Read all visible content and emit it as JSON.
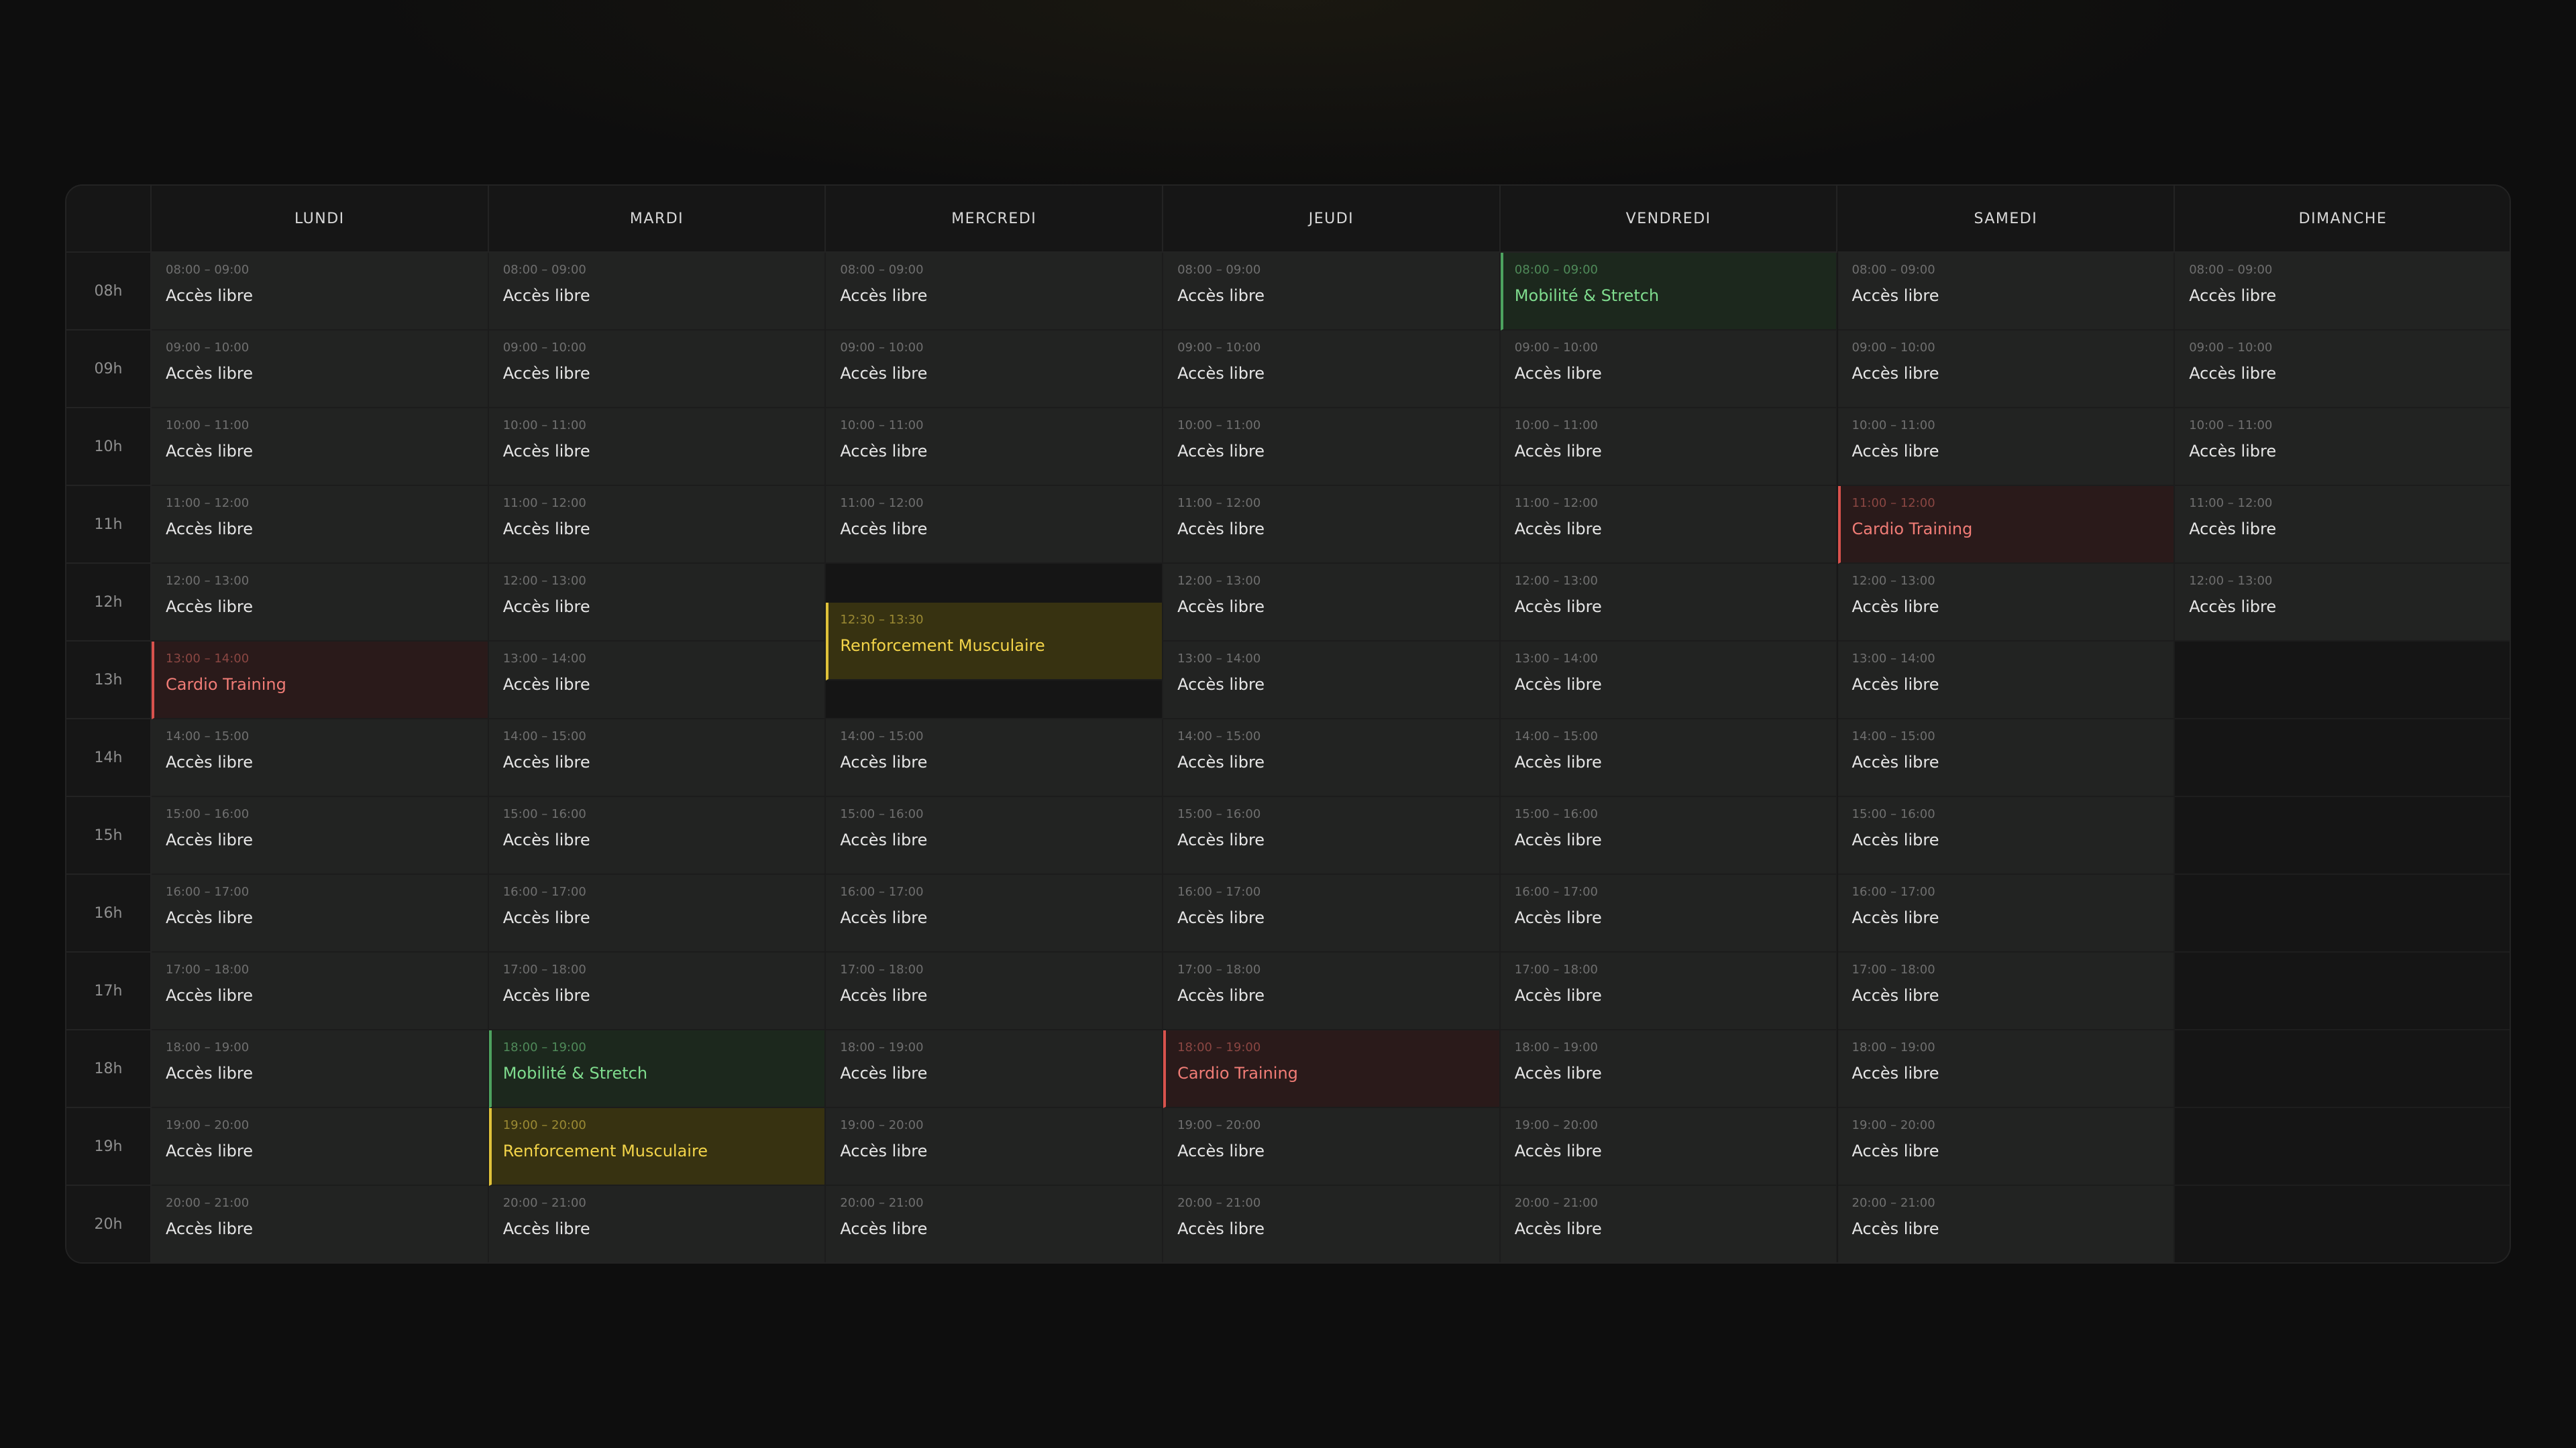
{
  "days": [
    "LUNDI",
    "MARDI",
    "MERCREDI",
    "JEUDI",
    "VENDREDI",
    "SAMEDI",
    "DIMANCHE"
  ],
  "hours": [
    "08h",
    "09h",
    "10h",
    "11h",
    "12h",
    "13h",
    "14h",
    "15h",
    "16h",
    "17h",
    "18h",
    "19h",
    "20h"
  ],
  "colors": {
    "cardio": "#f07c76",
    "mobility": "#7fdc8e",
    "strength": "#f3d449",
    "free": "#e6e6e6"
  },
  "columns": [
    [
      {
        "start": 0,
        "dur": 1,
        "time": "08:00 – 09:00",
        "label": "Accès libre",
        "type": "free"
      },
      {
        "start": 1,
        "dur": 1,
        "time": "09:00 – 10:00",
        "label": "Accès libre",
        "type": "free"
      },
      {
        "start": 2,
        "dur": 1,
        "time": "10:00 – 11:00",
        "label": "Accès libre",
        "type": "free"
      },
      {
        "start": 3,
        "dur": 1,
        "time": "11:00 – 12:00",
        "label": "Accès libre",
        "type": "free"
      },
      {
        "start": 4,
        "dur": 1,
        "time": "12:00 – 13:00",
        "label": "Accès libre",
        "type": "free"
      },
      {
        "start": 5,
        "dur": 1,
        "time": "13:00 – 14:00",
        "label": "Cardio Training",
        "type": "cardio"
      },
      {
        "start": 6,
        "dur": 1,
        "time": "14:00 – 15:00",
        "label": "Accès libre",
        "type": "free"
      },
      {
        "start": 7,
        "dur": 1,
        "time": "15:00 – 16:00",
        "label": "Accès libre",
        "type": "free"
      },
      {
        "start": 8,
        "dur": 1,
        "time": "16:00 – 17:00",
        "label": "Accès libre",
        "type": "free"
      },
      {
        "start": 9,
        "dur": 1,
        "time": "17:00 – 18:00",
        "label": "Accès libre",
        "type": "free"
      },
      {
        "start": 10,
        "dur": 1,
        "time": "18:00 – 19:00",
        "label": "Accès libre",
        "type": "free"
      },
      {
        "start": 11,
        "dur": 1,
        "time": "19:00 – 20:00",
        "label": "Accès libre",
        "type": "free"
      },
      {
        "start": 12,
        "dur": 1,
        "time": "20:00 – 21:00",
        "label": "Accès libre",
        "type": "free"
      }
    ],
    [
      {
        "start": 0,
        "dur": 1,
        "time": "08:00 – 09:00",
        "label": "Accès libre",
        "type": "free"
      },
      {
        "start": 1,
        "dur": 1,
        "time": "09:00 – 10:00",
        "label": "Accès libre",
        "type": "free"
      },
      {
        "start": 2,
        "dur": 1,
        "time": "10:00 – 11:00",
        "label": "Accès libre",
        "type": "free"
      },
      {
        "start": 3,
        "dur": 1,
        "time": "11:00 – 12:00",
        "label": "Accès libre",
        "type": "free"
      },
      {
        "start": 4,
        "dur": 1,
        "time": "12:00 – 13:00",
        "label": "Accès libre",
        "type": "free"
      },
      {
        "start": 5,
        "dur": 1,
        "time": "13:00 – 14:00",
        "label": "Accès libre",
        "type": "free"
      },
      {
        "start": 6,
        "dur": 1,
        "time": "14:00 – 15:00",
        "label": "Accès libre",
        "type": "free"
      },
      {
        "start": 7,
        "dur": 1,
        "time": "15:00 – 16:00",
        "label": "Accès libre",
        "type": "free"
      },
      {
        "start": 8,
        "dur": 1,
        "time": "16:00 – 17:00",
        "label": "Accès libre",
        "type": "free"
      },
      {
        "start": 9,
        "dur": 1,
        "time": "17:00 – 18:00",
        "label": "Accès libre",
        "type": "free"
      },
      {
        "start": 10,
        "dur": 1,
        "time": "18:00 – 19:00",
        "label": "Mobilité & Stretch",
        "type": "mobility"
      },
      {
        "start": 11,
        "dur": 1,
        "time": "19:00 – 20:00",
        "label": "Renforcement Musculaire",
        "type": "strength"
      },
      {
        "start": 12,
        "dur": 1,
        "time": "20:00 – 21:00",
        "label": "Accès libre",
        "type": "free"
      }
    ],
    [
      {
        "start": 0,
        "dur": 1,
        "time": "08:00 – 09:00",
        "label": "Accès libre",
        "type": "free"
      },
      {
        "start": 1,
        "dur": 1,
        "time": "09:00 – 10:00",
        "label": "Accès libre",
        "type": "free"
      },
      {
        "start": 2,
        "dur": 1,
        "time": "10:00 – 11:00",
        "label": "Accès libre",
        "type": "free"
      },
      {
        "start": 3,
        "dur": 1,
        "time": "11:00 – 12:00",
        "label": "Accès libre",
        "type": "free"
      },
      {
        "start": 4.5,
        "dur": 1,
        "time": "12:30 – 13:30",
        "label": "Renforcement Musculaire",
        "type": "strength"
      },
      {
        "start": 6,
        "dur": 1,
        "time": "14:00 – 15:00",
        "label": "Accès libre",
        "type": "free"
      },
      {
        "start": 7,
        "dur": 1,
        "time": "15:00 – 16:00",
        "label": "Accès libre",
        "type": "free"
      },
      {
        "start": 8,
        "dur": 1,
        "time": "16:00 – 17:00",
        "label": "Accès libre",
        "type": "free"
      },
      {
        "start": 9,
        "dur": 1,
        "time": "17:00 – 18:00",
        "label": "Accès libre",
        "type": "free"
      },
      {
        "start": 10,
        "dur": 1,
        "time": "18:00 – 19:00",
        "label": "Accès libre",
        "type": "free"
      },
      {
        "start": 11,
        "dur": 1,
        "time": "19:00 – 20:00",
        "label": "Accès libre",
        "type": "free"
      },
      {
        "start": 12,
        "dur": 1,
        "time": "20:00 – 21:00",
        "label": "Accès libre",
        "type": "free"
      }
    ],
    [
      {
        "start": 0,
        "dur": 1,
        "time": "08:00 – 09:00",
        "label": "Accès libre",
        "type": "free"
      },
      {
        "start": 1,
        "dur": 1,
        "time": "09:00 – 10:00",
        "label": "Accès libre",
        "type": "free"
      },
      {
        "start": 2,
        "dur": 1,
        "time": "10:00 – 11:00",
        "label": "Accès libre",
        "type": "free"
      },
      {
        "start": 3,
        "dur": 1,
        "time": "11:00 – 12:00",
        "label": "Accès libre",
        "type": "free"
      },
      {
        "start": 4,
        "dur": 1,
        "time": "12:00 – 13:00",
        "label": "Accès libre",
        "type": "free"
      },
      {
        "start": 5,
        "dur": 1,
        "time": "13:00 – 14:00",
        "label": "Accès libre",
        "type": "free"
      },
      {
        "start": 6,
        "dur": 1,
        "time": "14:00 – 15:00",
        "label": "Accès libre",
        "type": "free"
      },
      {
        "start": 7,
        "dur": 1,
        "time": "15:00 – 16:00",
        "label": "Accès libre",
        "type": "free"
      },
      {
        "start": 8,
        "dur": 1,
        "time": "16:00 – 17:00",
        "label": "Accès libre",
        "type": "free"
      },
      {
        "start": 9,
        "dur": 1,
        "time": "17:00 – 18:00",
        "label": "Accès libre",
        "type": "free"
      },
      {
        "start": 10,
        "dur": 1,
        "time": "18:00 – 19:00",
        "label": "Cardio Training",
        "type": "cardio"
      },
      {
        "start": 11,
        "dur": 1,
        "time": "19:00 – 20:00",
        "label": "Accès libre",
        "type": "free"
      },
      {
        "start": 12,
        "dur": 1,
        "time": "20:00 – 21:00",
        "label": "Accès libre",
        "type": "free"
      }
    ],
    [
      {
        "start": 0,
        "dur": 1,
        "time": "08:00 – 09:00",
        "label": "Mobilité & Stretch",
        "type": "mobility"
      },
      {
        "start": 1,
        "dur": 1,
        "time": "09:00 – 10:00",
        "label": "Accès libre",
        "type": "free"
      },
      {
        "start": 2,
        "dur": 1,
        "time": "10:00 – 11:00",
        "label": "Accès libre",
        "type": "free"
      },
      {
        "start": 3,
        "dur": 1,
        "time": "11:00 – 12:00",
        "label": "Accès libre",
        "type": "free"
      },
      {
        "start": 4,
        "dur": 1,
        "time": "12:00 – 13:00",
        "label": "Accès libre",
        "type": "free"
      },
      {
        "start": 5,
        "dur": 1,
        "time": "13:00 – 14:00",
        "label": "Accès libre",
        "type": "free"
      },
      {
        "start": 6,
        "dur": 1,
        "time": "14:00 – 15:00",
        "label": "Accès libre",
        "type": "free"
      },
      {
        "start": 7,
        "dur": 1,
        "time": "15:00 – 16:00",
        "label": "Accès libre",
        "type": "free"
      },
      {
        "start": 8,
        "dur": 1,
        "time": "16:00 – 17:00",
        "label": "Accès libre",
        "type": "free"
      },
      {
        "start": 9,
        "dur": 1,
        "time": "17:00 – 18:00",
        "label": "Accès libre",
        "type": "free"
      },
      {
        "start": 10,
        "dur": 1,
        "time": "18:00 – 19:00",
        "label": "Accès libre",
        "type": "free"
      },
      {
        "start": 11,
        "dur": 1,
        "time": "19:00 – 20:00",
        "label": "Accès libre",
        "type": "free"
      },
      {
        "start": 12,
        "dur": 1,
        "time": "20:00 – 21:00",
        "label": "Accès libre",
        "type": "free"
      }
    ],
    [
      {
        "start": 0,
        "dur": 1,
        "time": "08:00 – 09:00",
        "label": "Accès libre",
        "type": "free"
      },
      {
        "start": 1,
        "dur": 1,
        "time": "09:00 – 10:00",
        "label": "Accès libre",
        "type": "free"
      },
      {
        "start": 2,
        "dur": 1,
        "time": "10:00 – 11:00",
        "label": "Accès libre",
        "type": "free"
      },
      {
        "start": 3,
        "dur": 1,
        "time": "11:00 – 12:00",
        "label": "Cardio Training",
        "type": "cardio"
      },
      {
        "start": 4,
        "dur": 1,
        "time": "12:00 – 13:00",
        "label": "Accès libre",
        "type": "free"
      },
      {
        "start": 5,
        "dur": 1,
        "time": "13:00 – 14:00",
        "label": "Accès libre",
        "type": "free"
      },
      {
        "start": 6,
        "dur": 1,
        "time": "14:00 – 15:00",
        "label": "Accès libre",
        "type": "free"
      },
      {
        "start": 7,
        "dur": 1,
        "time": "15:00 – 16:00",
        "label": "Accès libre",
        "type": "free"
      },
      {
        "start": 8,
        "dur": 1,
        "time": "16:00 – 17:00",
        "label": "Accès libre",
        "type": "free"
      },
      {
        "start": 9,
        "dur": 1,
        "time": "17:00 – 18:00",
        "label": "Accès libre",
        "type": "free"
      },
      {
        "start": 10,
        "dur": 1,
        "time": "18:00 – 19:00",
        "label": "Accès libre",
        "type": "free"
      },
      {
        "start": 11,
        "dur": 1,
        "time": "19:00 – 20:00",
        "label": "Accès libre",
        "type": "free"
      },
      {
        "start": 12,
        "dur": 1,
        "time": "20:00 – 21:00",
        "label": "Accès libre",
        "type": "free"
      }
    ],
    [
      {
        "start": 0,
        "dur": 1,
        "time": "08:00 – 09:00",
        "label": "Accès libre",
        "type": "free"
      },
      {
        "start": 1,
        "dur": 1,
        "time": "09:00 – 10:00",
        "label": "Accès libre",
        "type": "free"
      },
      {
        "start": 2,
        "dur": 1,
        "time": "10:00 – 11:00",
        "label": "Accès libre",
        "type": "free"
      },
      {
        "start": 3,
        "dur": 1,
        "time": "11:00 – 12:00",
        "label": "Accès libre",
        "type": "free"
      },
      {
        "start": 4,
        "dur": 1,
        "time": "12:00 – 13:00",
        "label": "Accès libre",
        "type": "free"
      }
    ]
  ]
}
